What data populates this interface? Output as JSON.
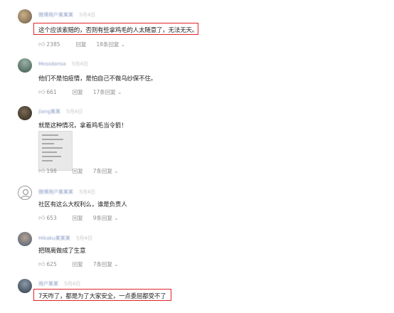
{
  "comments": [
    {
      "user": "微博用户某某某",
      "time": "5月4日",
      "text": "这个应该索赔的，否则有些拿鸡毛的人太随意了，无法无天。",
      "likes": "2385",
      "reply_label": "回复",
      "more_replies": "18条回复 ⌄"
    },
    {
      "user": "Mossdansa",
      "time": "5月4日",
      "text": "他们不是怕疫情，是怕自己不做乌纱保不住。",
      "likes": "661",
      "reply_label": "回复",
      "more_replies": "17条回复 ⌄"
    },
    {
      "user": "jiang某某",
      "time": "5月4日",
      "text": "就是这种情况，拿着鸡毛当令箭！",
      "likes": "198",
      "reply_label": "回复",
      "more_replies": "7条回复 ⌄"
    },
    {
      "user": "微博用户某某某",
      "time": "5月4日",
      "text": "社区有这么大权利么，谁是负责人",
      "likes": "653",
      "reply_label": "回复",
      "more_replies": "9条回复 ⌄"
    },
    {
      "user": "Hikaku某某某",
      "time": "5月4日",
      "text": "把隔离做成了生意",
      "likes": "625",
      "reply_label": "回复",
      "more_replies": "7条回复 ⌄"
    },
    {
      "user": "用户某某",
      "time": "5月4日",
      "text": "7天咋了，都是为了大家安全，一点委屈都受不了",
      "likes": "",
      "reply_label": "",
      "more_replies": ""
    }
  ],
  "colors": {
    "highlight": "#e0242a",
    "username": "#8b9cc6",
    "action": "#8f8f8f"
  },
  "icons": {
    "like": "thumbs-up-icon"
  }
}
